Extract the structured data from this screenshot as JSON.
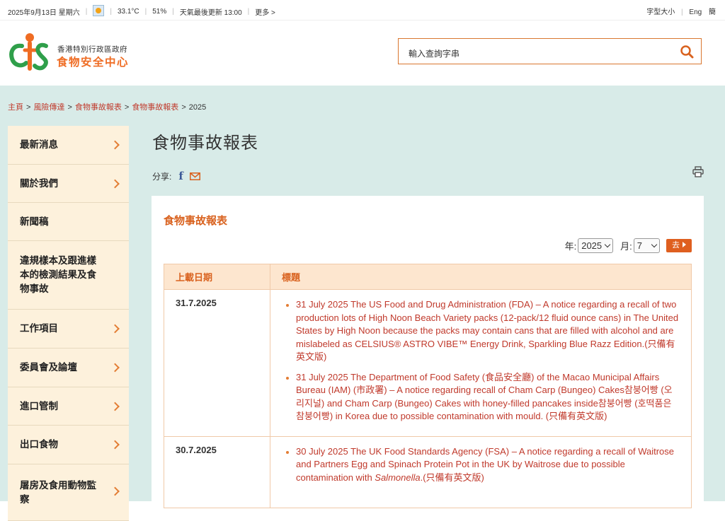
{
  "topbar": {
    "date": "2025年9月13日 星期六",
    "weather_icon": "sunny-icon",
    "temperature": "33.1°C",
    "humidity": "51%",
    "update": "天氣最後更新 13:00",
    "more": "更多 >",
    "font_size": "字型大小",
    "lang_en": "Eng",
    "lang_sc": "簡"
  },
  "header": {
    "logo_line1": "香港特別行政區政府",
    "logo_line2": "食物安全中心",
    "search_placeholder": "輸入查詢字串"
  },
  "breadcrumb": [
    "主頁",
    "風險傳達",
    "食物事故報表",
    "食物事故報表",
    "2025"
  ],
  "sidebar": {
    "items": [
      {
        "label": "最新消息",
        "arrow": true
      },
      {
        "label": "關於我們",
        "arrow": true
      },
      {
        "label": "新聞稿",
        "arrow": false
      },
      {
        "label": "違規樣本及跟進樣本的檢測結果及食物事故",
        "arrow": false
      },
      {
        "label": "工作項目",
        "arrow": true
      },
      {
        "label": "委員會及論壇",
        "arrow": true
      },
      {
        "label": "進口管制",
        "arrow": true
      },
      {
        "label": "出口食物",
        "arrow": true
      },
      {
        "label": "屠房及食用動物監察",
        "arrow": true
      }
    ]
  },
  "main": {
    "title": "食物事故報表",
    "share_label": "分享:",
    "panel_title": "食物事故報表",
    "year_label": "年:",
    "year_value": "2025",
    "month_label": "月:",
    "month_value": "7",
    "go_label": "去",
    "col_date": "上載日期",
    "col_title": "標題",
    "rows": [
      {
        "date": "31.7.2025",
        "items": [
          "31 July 2025 The US Food and Drug Administration (FDA) – A notice regarding a recall of two production lots of High Noon Beach Variety packs (12-pack/12 fluid ounce cans) in The United States by High Noon because the packs may contain cans that are filled with alcohol and are mislabeled as CELSIUS® ASTRO VIBE™ Energy Drink, Sparkling Blue Razz Edition.(只備有英文版)",
          "31 July 2025 The Department of Food Safety (食品安全廳) of the Macao Municipal Affairs Bureau (IAM) (市政署) – A notice regarding recall of Cham Carp (Bungeo) Cakes참붕어빵 (오리지널) and Cham Carp (Bungeo) Cakes with honey-filled pancakes inside참붕어빵 (호떡품은 참붕어빵) in Korea due to possible contamination with mould. (只備有英文版)"
        ]
      },
      {
        "date": "30.7.2025",
        "items": [
          "30 July 2025 The UK Food Standards Agency (FSA) – A notice regarding a recall of Waitrose and Partners Egg and Spinach Protein Pot in the UK by Waitrose due to possible contamination with Salmonella.(只備有英文版)"
        ]
      }
    ]
  },
  "colors": {
    "accent": "#df5f1f",
    "link": "#c0392b",
    "background": "#d8ebe8",
    "sidebar_bg": "#fdf1dc",
    "table_header_bg": "#fde6cf"
  }
}
